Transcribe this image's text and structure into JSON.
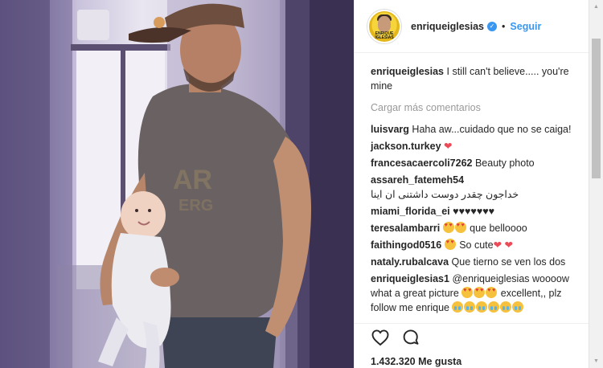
{
  "post": {
    "username": "enriqueiglesias",
    "follow_label": "Seguir",
    "separator": "•",
    "verified_icon": "verified-check-icon",
    "avatar_text": "ENRIQUE IGLESIAS"
  },
  "caption": {
    "username": "enriqueiglesias",
    "text": "I still can't believe..... you're mine"
  },
  "load_more_label": "Cargar más comentarios",
  "comments": [
    {
      "user": "luisvarg",
      "text": "Haha aw...cuidado que no se caiga!"
    },
    {
      "user": "jackson.turkey",
      "text": "",
      "trailing": "❤"
    },
    {
      "user": "francesacaercoli7262",
      "text": "Beauty photo"
    },
    {
      "user": "assareh_fatemeh54",
      "text": "خداجون چقدر دوست داشتنی ان اینا"
    },
    {
      "user": "miami_florida_ei",
      "text": "♥♥♥♥♥♥♥"
    },
    {
      "user": "teresalambarri",
      "text": "que belloooo"
    },
    {
      "user": "faithingod0516",
      "text": "So cute",
      "trailing": "❤ ❤"
    },
    {
      "user": "nataly.rubalcava",
      "text": "Que tierno se ven los dos"
    },
    {
      "user": "enriqueiglesias1",
      "text": "@enriqueiglesias woooow what a great picture",
      "text2": "excellent,, plz follow me enrique"
    }
  ],
  "actions": {
    "like_icon": "heart-outline-icon",
    "comment_icon": "comment-bubble-icon"
  },
  "likes_text": "1.432.320 Me gusta",
  "colors": {
    "accent": "#3897f0",
    "text": "#262626",
    "muted": "#999999",
    "heart": "#ed4956"
  }
}
